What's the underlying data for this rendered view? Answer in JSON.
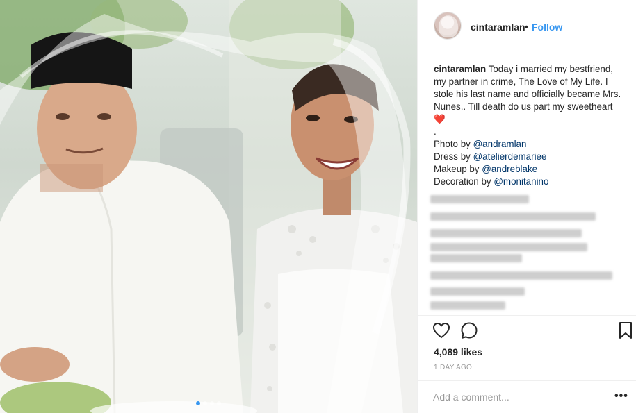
{
  "photo": {
    "carousel_count": 4,
    "active_index": 0
  },
  "header": {
    "username": "cintaramlan",
    "separator": "•",
    "follow_label": "Follow"
  },
  "caption": {
    "username": "cintaramlan",
    "text": "Today i married my bestfriend, my partner in crime, The Love of My Life. I stole his last name and officially became Mrs. Nunes.. Till death do us part my sweetheart ❤️",
    "dot": ".",
    "credits": [
      {
        "label": "Photo by ",
        "handle": "@andramlan"
      },
      {
        "label": "Dress by ",
        "handle": "@atelierdemariee"
      },
      {
        "label": "Makeup by ",
        "handle": "@andreblake_"
      },
      {
        "label": "Decoration by ",
        "handle": "@monitanino"
      }
    ]
  },
  "stats": {
    "likes": "4,089 likes",
    "time": "1 DAY AGO"
  },
  "comment": {
    "placeholder": "Add a comment..."
  },
  "more": "•••",
  "icons": [
    "heart-icon",
    "comment-icon",
    "bookmark-icon"
  ],
  "colors": {
    "link": "#3897f0",
    "handle": "#003569",
    "muted": "#999999",
    "text": "#262626"
  }
}
